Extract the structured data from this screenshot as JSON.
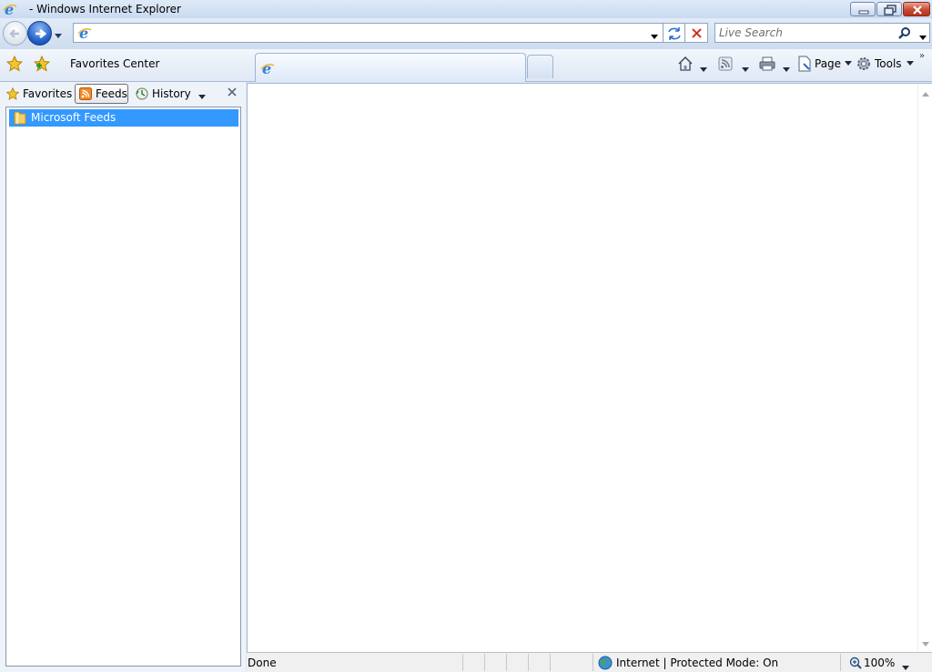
{
  "window": {
    "title": " - Windows Internet Explorer"
  },
  "address_bar": {
    "url": "",
    "search_placeholder": "Live Search"
  },
  "command_bar": {
    "favorites_center_label": "Favorites Center",
    "page_label": "Page",
    "tools_label": "Tools",
    "chevron": "»"
  },
  "favorites_center": {
    "tabs": [
      {
        "label": "Favorites",
        "icon": "star-icon"
      },
      {
        "label": "Feeds",
        "icon": "rss-icon",
        "selected": true
      },
      {
        "label": "History",
        "icon": "history-icon"
      }
    ],
    "feeds": [
      {
        "label": "Microsoft Feeds",
        "icon": "folder-icon",
        "selected": true
      }
    ]
  },
  "status_bar": {
    "status": "Done",
    "zone": "Internet | Protected Mode: On",
    "zoom": "100%"
  },
  "colors": {
    "chrome": "#dbe6f4",
    "selection": "#3399ff",
    "close_button": "#c74a33",
    "forward_button": "#1f5fc9"
  }
}
